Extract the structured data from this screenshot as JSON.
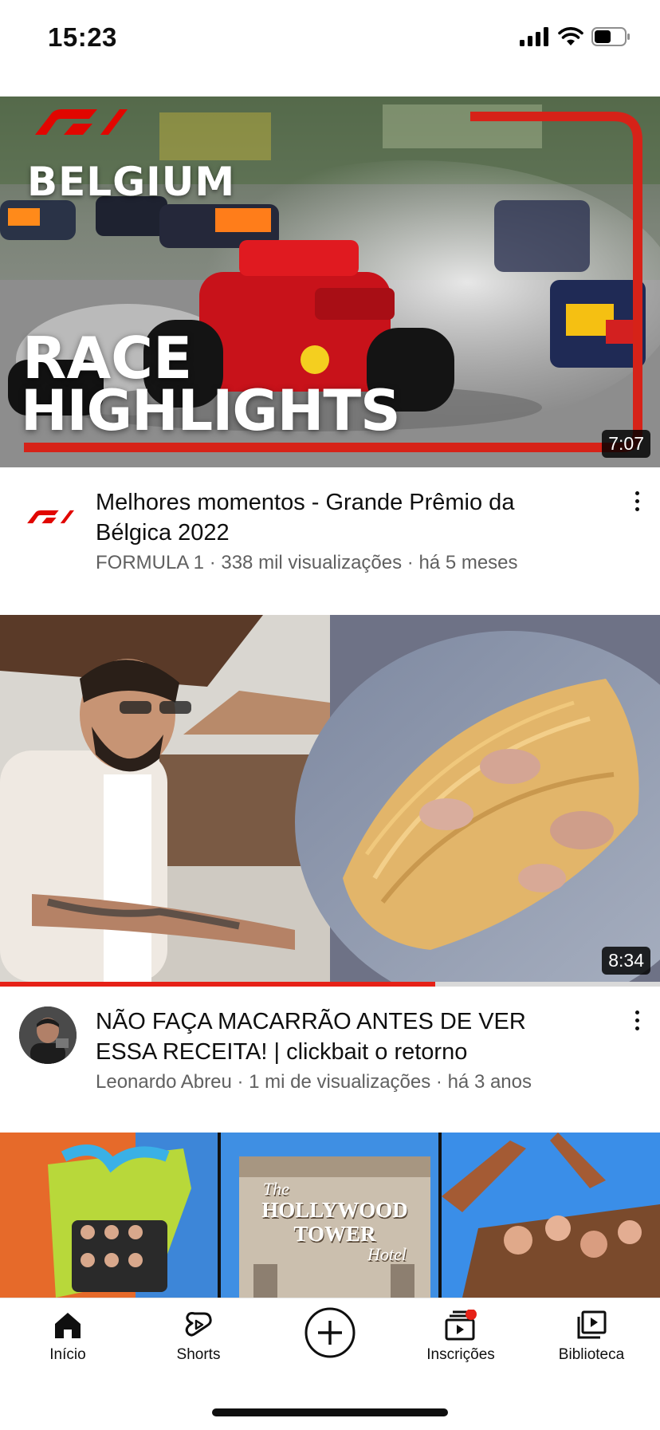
{
  "status_bar": {
    "time": "15:23",
    "battery_level": 0.55
  },
  "feed": [
    {
      "thumbnail": {
        "overlay_top": "BELGIUM",
        "overlay_line1": "RACE",
        "overlay_line2": "HIGHLIGHTS",
        "brand": "F1"
      },
      "duration": "7:07",
      "title": "Melhores momentos - Grande Prêmio da Bélgica 2022",
      "subtitle": "FORMULA 1 · 338 mil visualizações · há 5 meses"
    },
    {
      "duration": "8:34",
      "watch_progress": 0.66,
      "title": "NÃO FAÇA MACARRÃO ANTES DE VER ESSA RECEITA! | clickbait o retorno",
      "subtitle": "Leonardo Abreu · 1 mi de visualizações · há 3 anos"
    },
    {
      "thumbnail": {
        "sign_line1": "The",
        "sign_line2": "HOLLYWOOD",
        "sign_line3": "TOWER",
        "sign_line4": "Hotel"
      }
    }
  ],
  "nav": [
    {
      "label": "Início",
      "icon": "home-icon",
      "active": true
    },
    {
      "label": "Shorts",
      "icon": "shorts-icon"
    },
    {
      "label": "",
      "icon": "create-plus-icon"
    },
    {
      "label": "Inscrições",
      "icon": "subscriptions-icon",
      "badge": true
    },
    {
      "label": "Biblioteca",
      "icon": "library-icon"
    }
  ],
  "colors": {
    "accent_red": "#e62117",
    "text_primary": "#0f0f0f",
    "text_secondary": "#606060"
  }
}
